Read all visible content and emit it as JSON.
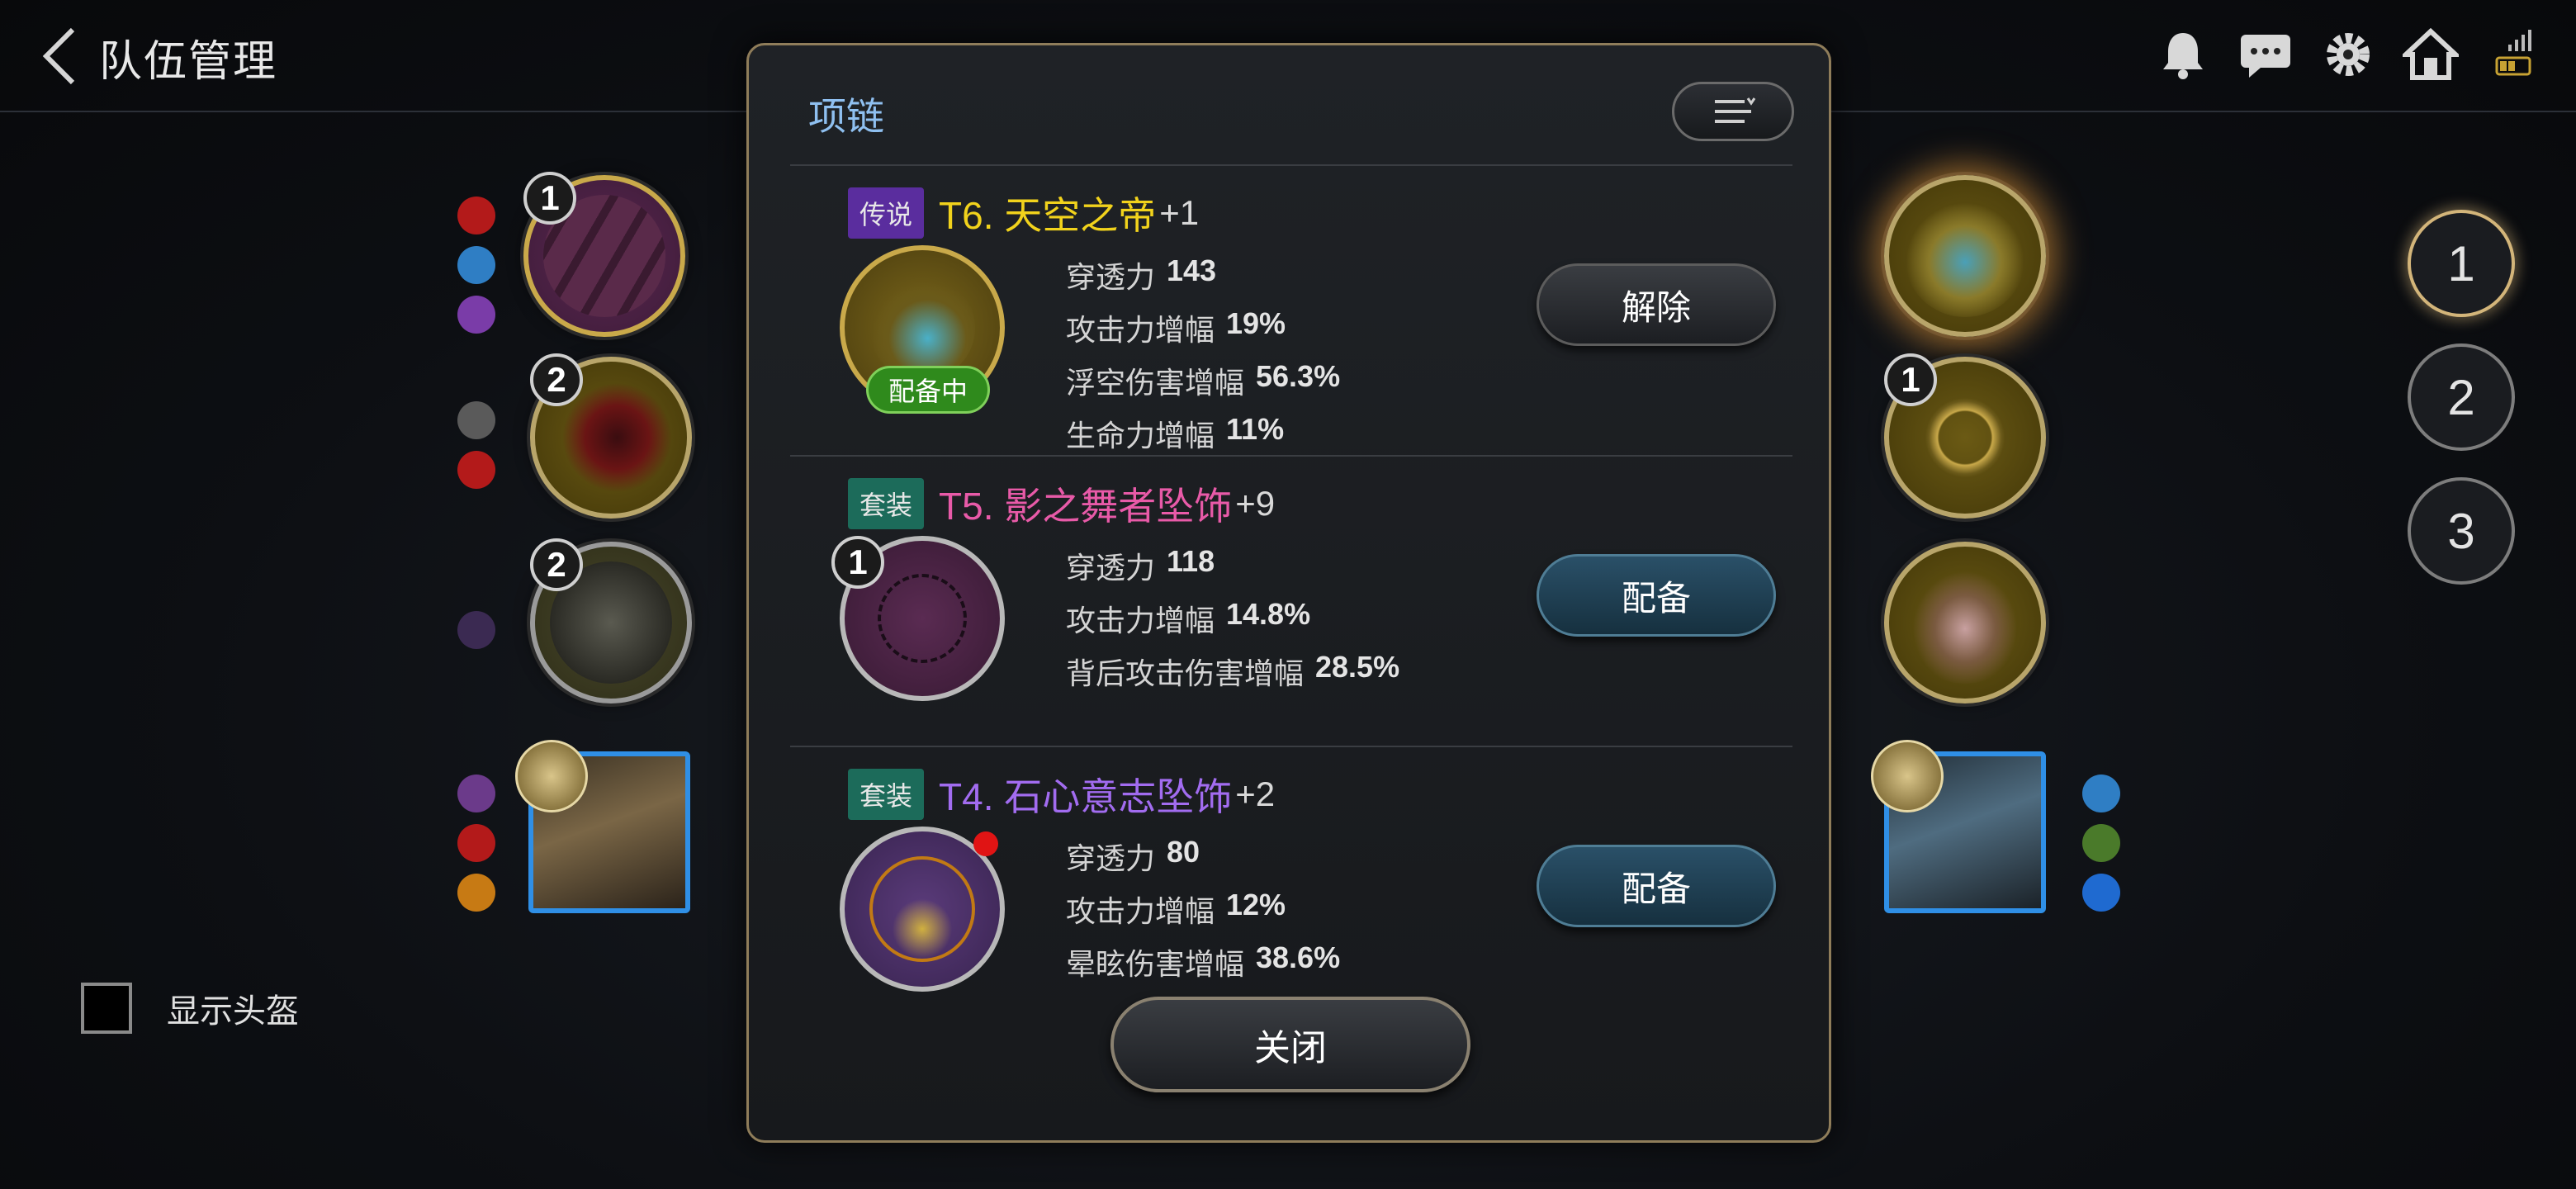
{
  "header": {
    "title": "队伍管理",
    "icons": [
      "bell-icon",
      "chat-icon",
      "gear-icon",
      "home-icon",
      "signal-battery-icon"
    ]
  },
  "left_slots": [
    {
      "level": "1",
      "tone": "purple"
    },
    {
      "level": "2",
      "tone": "gold"
    },
    {
      "level": "2",
      "tone": "dark"
    }
  ],
  "right_slots": [
    {
      "level": "",
      "tone": "gold"
    },
    {
      "level": "1",
      "tone": "gold"
    },
    {
      "level": "",
      "tone": "gold"
    }
  ],
  "set_buttons": [
    "1",
    "2",
    "3"
  ],
  "helmet_toggle": {
    "label": "显示头盔",
    "checked": false
  },
  "modal": {
    "title": "项链",
    "close_label": "关闭",
    "items": [
      {
        "rarity": "传说",
        "name": "T6. 天空之帝",
        "plus": "+1",
        "name_color": "#f1d21c",
        "equipped_tag": "配备中",
        "stats": [
          {
            "label": "穿透力",
            "value": "143"
          },
          {
            "label": "攻击力增幅",
            "value": "19%"
          },
          {
            "label": "浮空伤害增幅",
            "value": "56.3%"
          },
          {
            "label": "生命力增幅",
            "value": "11%"
          }
        ],
        "action": "解除"
      },
      {
        "rarity": "套装",
        "name": "T5. 影之舞者坠饰",
        "plus": "+9",
        "name_color": "#e85aa8",
        "level": "1",
        "stats": [
          {
            "label": "穿透力",
            "value": "118"
          },
          {
            "label": "攻击力增幅",
            "value": "14.8%"
          },
          {
            "label": "背后攻击伤害增幅",
            "value": "28.5%"
          }
        ],
        "action": "配备"
      },
      {
        "rarity": "套装",
        "name": "T4. 石心意志坠饰",
        "plus": "+2",
        "name_color": "#a26cf0",
        "stats": [
          {
            "label": "穿透力",
            "value": "80"
          },
          {
            "label": "攻击力增幅",
            "value": "12%"
          },
          {
            "label": "晕眩伤害增幅",
            "value": "38.6%"
          }
        ],
        "action": "配备"
      }
    ]
  }
}
